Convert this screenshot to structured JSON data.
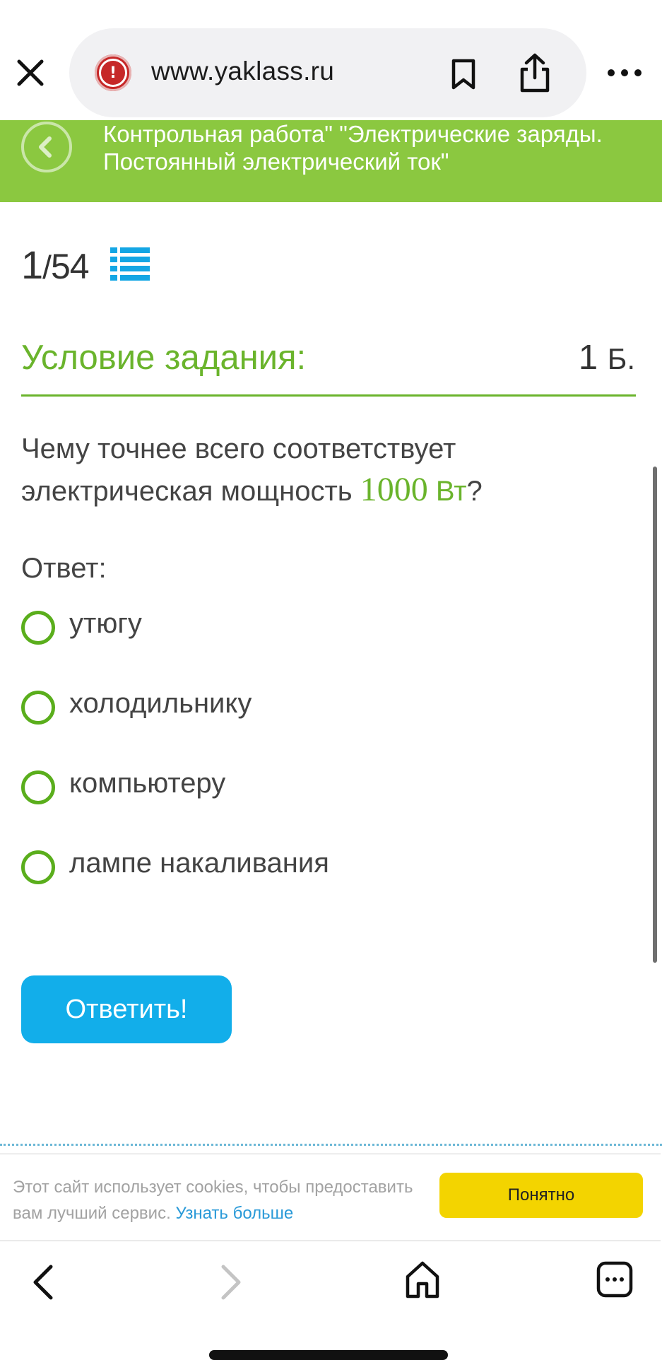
{
  "browser": {
    "url": "www.yaklass.ru",
    "icons": {
      "close": "close-icon",
      "security": "alert-circle-icon",
      "bookmark": "bookmark-icon",
      "share": "share-icon",
      "more": "more-horizontal-icon"
    }
  },
  "header": {
    "title_line1": "Контрольная работа\" \"Электрические заряды.",
    "title_line2": "Постоянный электрический ток\"",
    "background_color": "#8bc840"
  },
  "progress": {
    "current": "1",
    "separator": "/",
    "total": "54"
  },
  "task": {
    "condition_title": "Условие задания:",
    "points_value": "1",
    "points_unit": "Б.",
    "question_text": "Чему точнее всего соответствует электрическая мощность ",
    "question_number": "1000",
    "question_unit": "Вт",
    "question_end": "?",
    "answer_label": "Ответ:",
    "options": [
      {
        "label": "утюгу",
        "selected": false
      },
      {
        "label": "холодильнику",
        "selected": false
      },
      {
        "label": "компьютеру",
        "selected": false
      },
      {
        "label": "лампе накаливания",
        "selected": false
      }
    ],
    "submit_label": "Ответить!"
  },
  "cookie": {
    "text": "Этот сайт использует cookies, чтобы предоставить вам лучший сервис. ",
    "link": "Узнать больше",
    "button": "Понятно"
  },
  "colors": {
    "accent_green": "#6ab42c",
    "button_blue": "#12aeea",
    "cookie_yellow": "#f3d400"
  }
}
